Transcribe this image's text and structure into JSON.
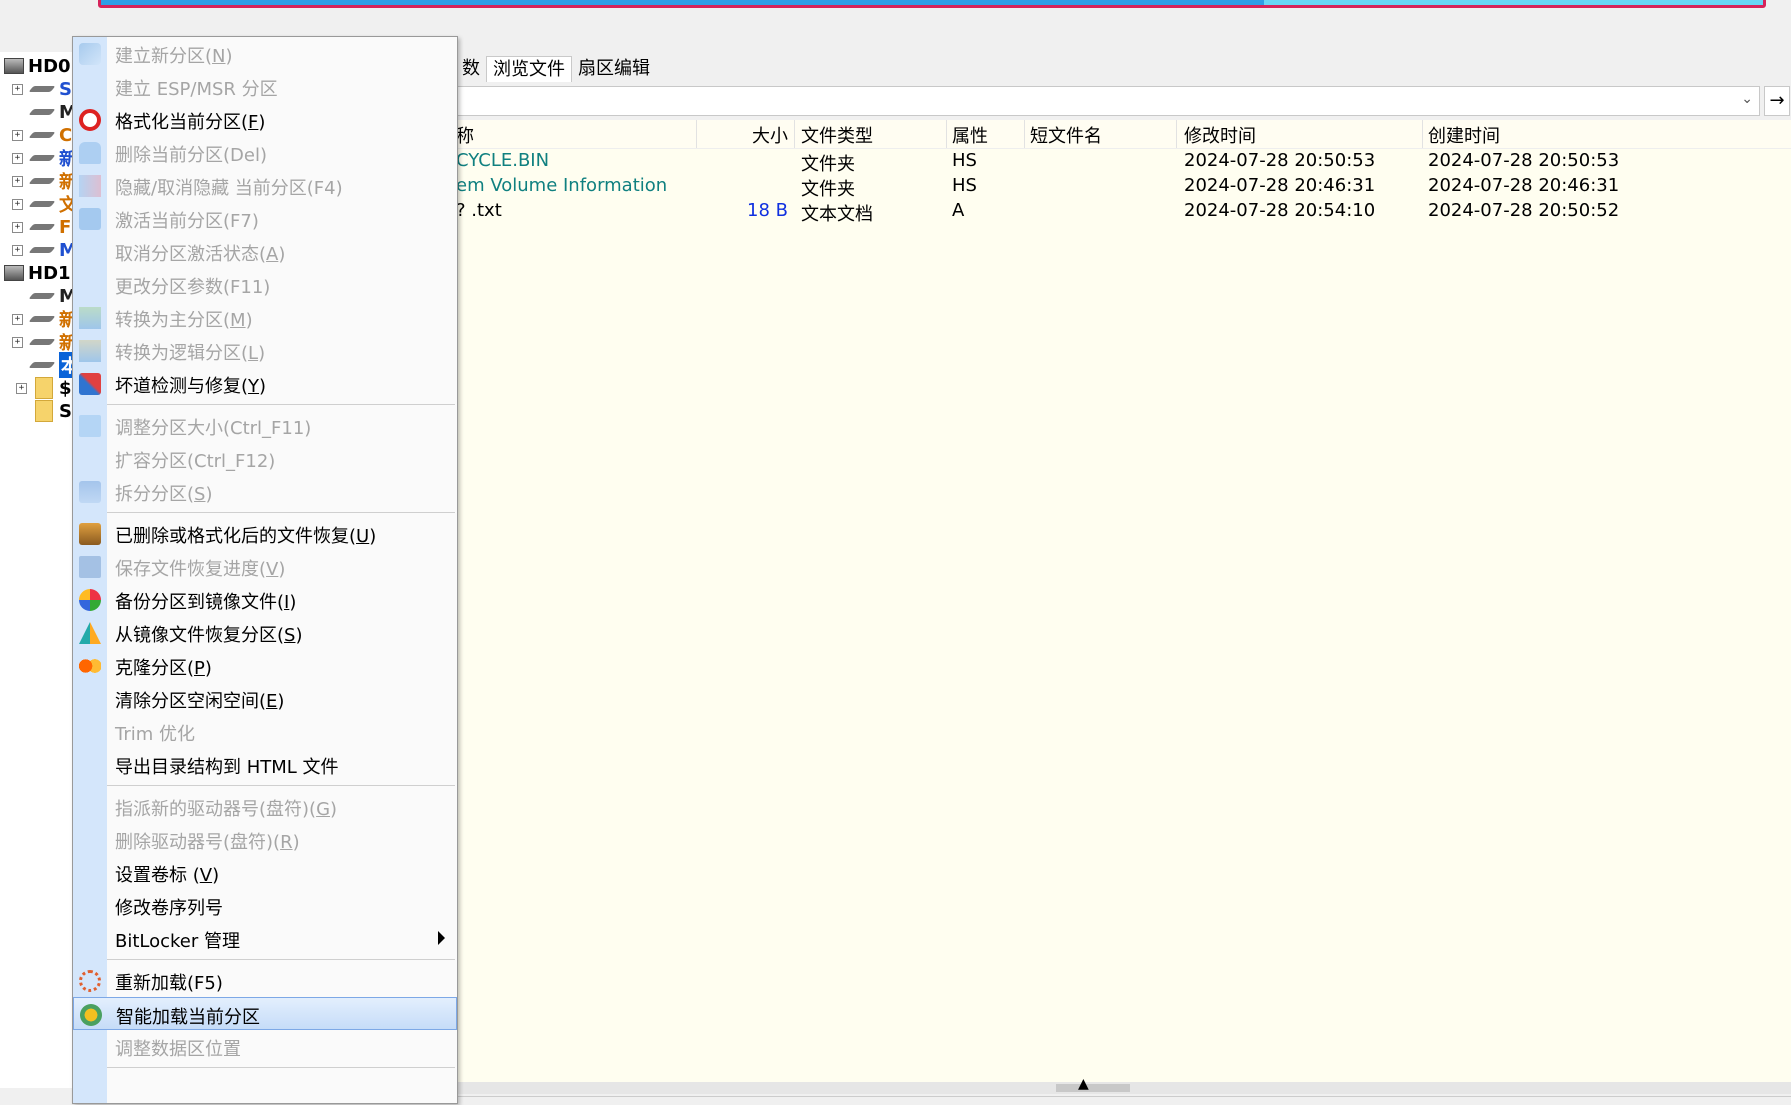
{
  "progress": {
    "fraction": 0.7,
    "colors": {
      "border": "#d6235a",
      "bg": "#68d6f5",
      "fill": "#2f9ee6"
    }
  },
  "tree": {
    "nodes": [
      {
        "label": "HD0",
        "kind": "disk",
        "depth": 0
      },
      {
        "label": "S",
        "kind": "partition",
        "color": "blue"
      },
      {
        "label": "M",
        "kind": "partition",
        "color": "dark"
      },
      {
        "label": "C",
        "kind": "partition",
        "color": "orange"
      },
      {
        "label": "新",
        "kind": "partition",
        "color": "blue"
      },
      {
        "label": "新",
        "kind": "partition",
        "color": "orange"
      },
      {
        "label": "文",
        "kind": "partition",
        "color": "orange"
      },
      {
        "label": "F",
        "kind": "partition",
        "color": "orange"
      },
      {
        "label": "M",
        "kind": "partition",
        "color": "blue"
      },
      {
        "label": "HD1",
        "kind": "disk",
        "depth": 0
      },
      {
        "label": "M",
        "kind": "partition",
        "color": "dark"
      },
      {
        "label": "新",
        "kind": "partition",
        "color": "orange"
      },
      {
        "label": "新",
        "kind": "partition",
        "color": "orange"
      },
      {
        "label": "本地",
        "kind": "partition-selected"
      },
      {
        "label": "$",
        "kind": "folder"
      },
      {
        "label": "S",
        "kind": "folder"
      }
    ]
  },
  "tabs": [
    {
      "label": "数",
      "active": false
    },
    {
      "label": "浏览文件",
      "active": true
    },
    {
      "label": "扇区编辑",
      "active": false
    }
  ],
  "filelist": {
    "columns": [
      "称",
      "大小",
      "文件类型",
      "属性",
      "短文件名",
      "修改时间",
      "创建时间"
    ],
    "rows": [
      {
        "name": "CYCLE.BIN",
        "size": "",
        "type": "文件夹",
        "attr": "HS",
        "short": "",
        "modified": "2024-07-28 20:50:53",
        "created": "2024-07-28 20:50:53",
        "nameColor": "teal"
      },
      {
        "name": "em Volume Information",
        "size": "",
        "type": "文件夹",
        "attr": "HS",
        "short": "",
        "modified": "2024-07-28 20:46:31",
        "created": "2024-07-28 20:46:31",
        "nameColor": "teal"
      },
      {
        "name": "? .txt",
        "size": "18 B",
        "type": "文本文档",
        "attr": "A",
        "short": "",
        "modified": "2024-07-28 20:54:10",
        "created": "2024-07-28 20:50:52",
        "nameColor": "black"
      }
    ]
  },
  "menu": {
    "items": [
      {
        "text": "建立新分区(",
        "key": "N",
        "tail": ")",
        "disabled": true,
        "icon": "new-partition-icon"
      },
      {
        "text": "建立 ESP/MSR 分区",
        "key": "",
        "tail": "",
        "disabled": true,
        "icon": ""
      },
      {
        "text": "格式化当前分区(",
        "key": "F",
        "tail": ")",
        "disabled": false,
        "icon": "format-icon"
      },
      {
        "text": "删除当前分区(Del)",
        "key": "",
        "tail": "",
        "disabled": true,
        "icon": "delete-partition-icon"
      },
      {
        "text": "隐藏/取消隐藏 当前分区(F4)",
        "key": "",
        "tail": "",
        "disabled": true,
        "icon": "hide-partition-icon"
      },
      {
        "text": "激活当前分区(F7)",
        "key": "",
        "tail": "",
        "disabled": true,
        "icon": "activate-partition-icon"
      },
      {
        "text": "取消分区激活状态(",
        "key": "A",
        "tail": ")",
        "disabled": true,
        "icon": ""
      },
      {
        "text": "更改分区参数(F11)",
        "key": "",
        "tail": "",
        "disabled": true,
        "icon": ""
      },
      {
        "text": "转换为主分区(",
        "key": "M",
        "tail": ")",
        "disabled": true,
        "icon": "convert-primary-icon"
      },
      {
        "text": "转换为逻辑分区(",
        "key": "L",
        "tail": ")",
        "disabled": true,
        "icon": "convert-logical-icon"
      },
      {
        "text": "坏道检测与修复(",
        "key": "Y",
        "tail": ")",
        "disabled": false,
        "icon": "bad-sector-repair-icon"
      },
      {
        "sep": true
      },
      {
        "text": "调整分区大小(Ctrl_F11)",
        "key": "",
        "tail": "",
        "disabled": true,
        "icon": "resize-partition-icon"
      },
      {
        "text": "扩容分区(Ctrl_F12)",
        "key": "",
        "tail": "",
        "disabled": true,
        "icon": ""
      },
      {
        "text": "拆分分区(",
        "key": "S",
        "tail": ")",
        "disabled": true,
        "icon": "split-partition-icon"
      },
      {
        "sep": true
      },
      {
        "text": "已删除或格式化后的文件恢复(",
        "key": "U",
        "tail": ")",
        "disabled": false,
        "icon": "file-recovery-icon"
      },
      {
        "text": "保存文件恢复进度(",
        "key": "V",
        "tail": ")",
        "disabled": true,
        "icon": "save-progress-icon"
      },
      {
        "text": "备份分区到镜像文件(",
        "key": "I",
        "tail": ")",
        "disabled": false,
        "icon": "backup-image-icon"
      },
      {
        "text": "从镜像文件恢复分区(",
        "key": "S",
        "tail": ")",
        "disabled": false,
        "icon": "restore-image-icon"
      },
      {
        "text": "克隆分区(",
        "key": "P",
        "tail": ")",
        "disabled": false,
        "icon": "clone-partition-icon"
      },
      {
        "text": "清除分区空闲空间(",
        "key": "E",
        "tail": ")",
        "disabled": false,
        "icon": ""
      },
      {
        "text": "Trim 优化",
        "key": "",
        "tail": "",
        "disabled": true,
        "icon": ""
      },
      {
        "text": "导出目录结构到 HTML 文件",
        "key": "",
        "tail": "",
        "disabled": false,
        "icon": ""
      },
      {
        "sep": true
      },
      {
        "text": "指派新的驱动器号(盘符)(",
        "key": "G",
        "tail": ")",
        "disabled": true,
        "icon": ""
      },
      {
        "text": "删除驱动器号(盘符)(",
        "key": "R",
        "tail": ")",
        "disabled": true,
        "icon": ""
      },
      {
        "text": "设置卷标 (",
        "key": "V",
        "tail": ")",
        "disabled": false,
        "icon": ""
      },
      {
        "text": "修改卷序列号",
        "key": "",
        "tail": "",
        "disabled": false,
        "icon": ""
      },
      {
        "text": "BitLocker 管理",
        "key": "",
        "tail": "",
        "disabled": false,
        "icon": "",
        "submenu": true
      },
      {
        "sep": true
      },
      {
        "text": "重新加载(F5)",
        "key": "",
        "tail": "",
        "disabled": false,
        "icon": "reload-icon"
      },
      {
        "text": "智能加载当前分区",
        "key": "",
        "tail": "",
        "disabled": false,
        "icon": "smart-load-icon",
        "highlight": true
      },
      {
        "text": "调整数据区位置",
        "key": "",
        "tail": "",
        "disabled": true,
        "icon": ""
      },
      {
        "sep": true
      }
    ]
  }
}
